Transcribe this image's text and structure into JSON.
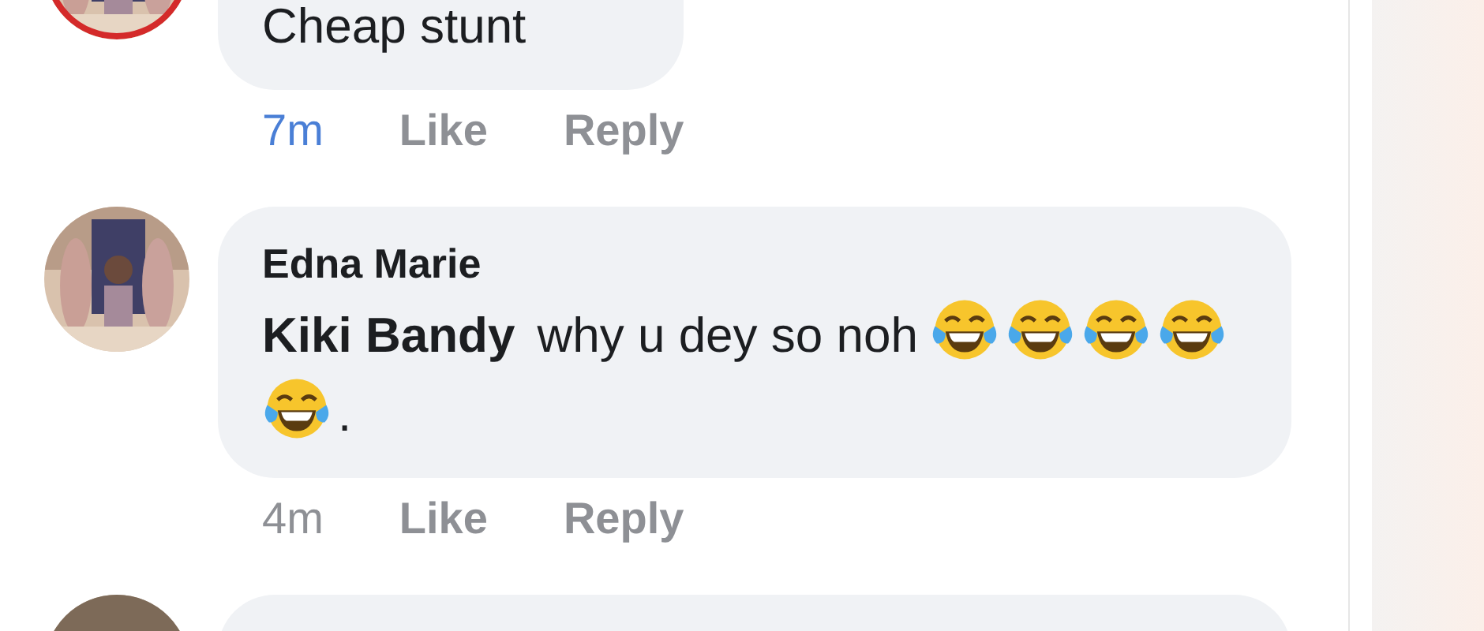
{
  "comments": [
    {
      "body": [
        {
          "kind": "text",
          "text": "Cheap stunt"
        }
      ],
      "time": "7m",
      "recent": true,
      "actions": [
        "Like",
        "Reply"
      ]
    },
    {
      "author": "Edna Marie",
      "body": [
        {
          "kind": "mention",
          "text": "Kiki Bandy"
        },
        {
          "kind": "text",
          "text": "why u dey so noh"
        },
        {
          "kind": "emoji"
        },
        {
          "kind": "emoji"
        },
        {
          "kind": "emoji"
        },
        {
          "kind": "emoji"
        },
        {
          "kind": "emoji"
        },
        {
          "kind": "text",
          "text": "."
        }
      ],
      "time": "4m",
      "recent": false,
      "actions": [
        "Like",
        "Reply"
      ]
    }
  ]
}
